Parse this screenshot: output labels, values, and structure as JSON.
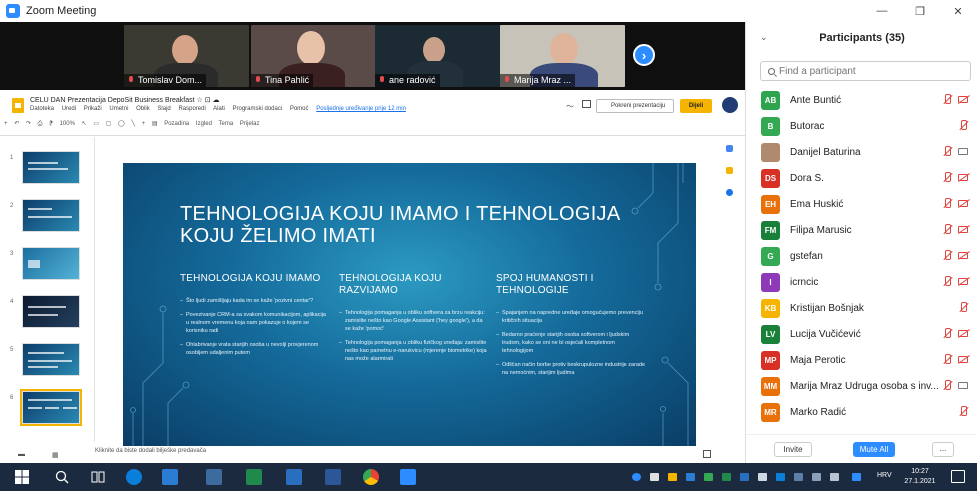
{
  "window": {
    "title": "Zoom Meeting",
    "controls": [
      "—",
      "❐",
      "✕"
    ]
  },
  "video_tiles": [
    {
      "name": "Tomislav Dom...",
      "bg": "#3a3a33",
      "head": "#d4a388",
      "body": "#2b2b2b"
    },
    {
      "name": "Tina Pahlić",
      "bg": "#5a4a48",
      "head": "#e8c2a8",
      "body": "#3a2020"
    },
    {
      "name": "ane radović",
      "bg": "#1c2a33",
      "head": "#c9a08a",
      "body": "#22303a"
    },
    {
      "name": "Marija Mraz ...",
      "bg": "#c7c3b8",
      "head": "#e0b49a",
      "body": "#3a4a7a"
    }
  ],
  "next_arrow": "›",
  "doc": {
    "title": "CELU DAN Prezentacija DepoSit Business Breakfast ☆ ⊡ ☁",
    "menus": [
      "Datoteka",
      "Uredi",
      "Prikaži",
      "Umetni",
      "Oblik",
      "Slajd",
      "Rasporedi",
      "Alati",
      "Programski dodaci",
      "Pomoć"
    ],
    "last_edit": "Posljednje uređivanje prije 12 min",
    "toolbar": [
      "+",
      "↶",
      "↷",
      "⎙",
      "⁋",
      "100%",
      "↖",
      "▭",
      "▢",
      "◯",
      "╲",
      "+",
      "▤",
      "Pozadina",
      "Izgled",
      "Tema",
      "Prijelaz"
    ],
    "present_label": "Pokreni prezentaciju",
    "share_label": "Dijeli",
    "notes": "Kliknite da biste dodali bilješke predavača"
  },
  "thumbnails": [
    {
      "num": "1",
      "active": false
    },
    {
      "num": "2",
      "active": false
    },
    {
      "num": "3",
      "active": false
    },
    {
      "num": "4",
      "active": false
    },
    {
      "num": "5",
      "active": false
    },
    {
      "num": "6",
      "active": true
    }
  ],
  "slide": {
    "title": "TEHNOLOGIJA KOJU IMAMO I TEHNOLOGIJA KOJU ŽELIMO IMATI",
    "columns": [
      {
        "heading": "TEHNOLOGIJA KOJU IMAMO",
        "bullets": [
          "Što ljudi zamišljaju kada im se kaže 'pozivni centar'?",
          "Povezivanje CRM-a sa svakom komunikacijom, aplikacija u realnom vremenu koja nam pokazuje o kojem se korisniku radi",
          "Ohlabrivanje vrata starijih osoba u nevolji provjerenom osobljem udaljenim putem"
        ]
      },
      {
        "heading": "TEHNOLOGIJA KOJU RAZVIJAMO",
        "bullets": [
          "Tehnologija pomaganja u obliku softvera za brzu reakciju: zamislite nešto kao Google Assistant ('hey google'), a da se kaže 'pomoć'",
          "Tehnologija pomaganja u obliku fizičkog uređaja: zamislite nešto kao pametnu e-narukvicu (mjerenje biometrike) koja nas može alarmirati"
        ]
      },
      {
        "heading": "SPOJ HUMANOSTI I TEHNOLOGIJE",
        "bullets": [
          "Spajanjem na naprednе uređaje omogućujemo prevenciju kritičnih situacija",
          "Bedarno praćenje starijih osoba softverom i ljudskim trudom, kako se oni ne bi osjećali kompletnom tehnologijom",
          "Odličan način borbe protiv beskrupuloznе industrije zarade na nemoćnim, starijim ljudima"
        ]
      }
    ]
  },
  "panel": {
    "title": "Participants (35)",
    "search_placeholder": "Find a participant",
    "participants": [
      {
        "initials": "AB",
        "name": "Ante Buntić",
        "color": "#2ea44f",
        "cam": "off"
      },
      {
        "initials": "B",
        "name": "Butorac",
        "color": "#34a853",
        "cam": "none"
      },
      {
        "initials": "",
        "name": "Danijel Baturina",
        "color": "#b08a6e",
        "cam": "on"
      },
      {
        "initials": "DS",
        "name": "Dora S.",
        "color": "#d93025",
        "cam": "off"
      },
      {
        "initials": "EH",
        "name": "Ema Huskić",
        "color": "#e8710a",
        "cam": "off"
      },
      {
        "initials": "FM",
        "name": "Filipa Marusic",
        "color": "#188038",
        "cam": "off"
      },
      {
        "initials": "G",
        "name": "gstefan",
        "color": "#34a853",
        "cam": "off"
      },
      {
        "initials": "I",
        "name": "icrncic",
        "color": "#8e3ab8",
        "cam": "off"
      },
      {
        "initials": "KB",
        "name": "Kristijan Bošnjak",
        "color": "#f4b400",
        "cam": "none"
      },
      {
        "initials": "LV",
        "name": "Lucija Vučićević",
        "color": "#188038",
        "cam": "off"
      },
      {
        "initials": "MP",
        "name": "Maja Perotic",
        "color": "#d93025",
        "cam": "off"
      },
      {
        "initials": "MM",
        "name": "Marija Mraz Udruga osoba s inv...",
        "color": "#e8710a",
        "cam": "on"
      },
      {
        "initials": "MR",
        "name": "Marko Radić",
        "color": "#e8710a",
        "cam": "none"
      }
    ],
    "invite_label": "Invite",
    "mute_all_label": "Mute All",
    "more_label": "..."
  },
  "taskbar": {
    "lang": "HRV",
    "time": "10:27",
    "date": "27.1.2021"
  }
}
